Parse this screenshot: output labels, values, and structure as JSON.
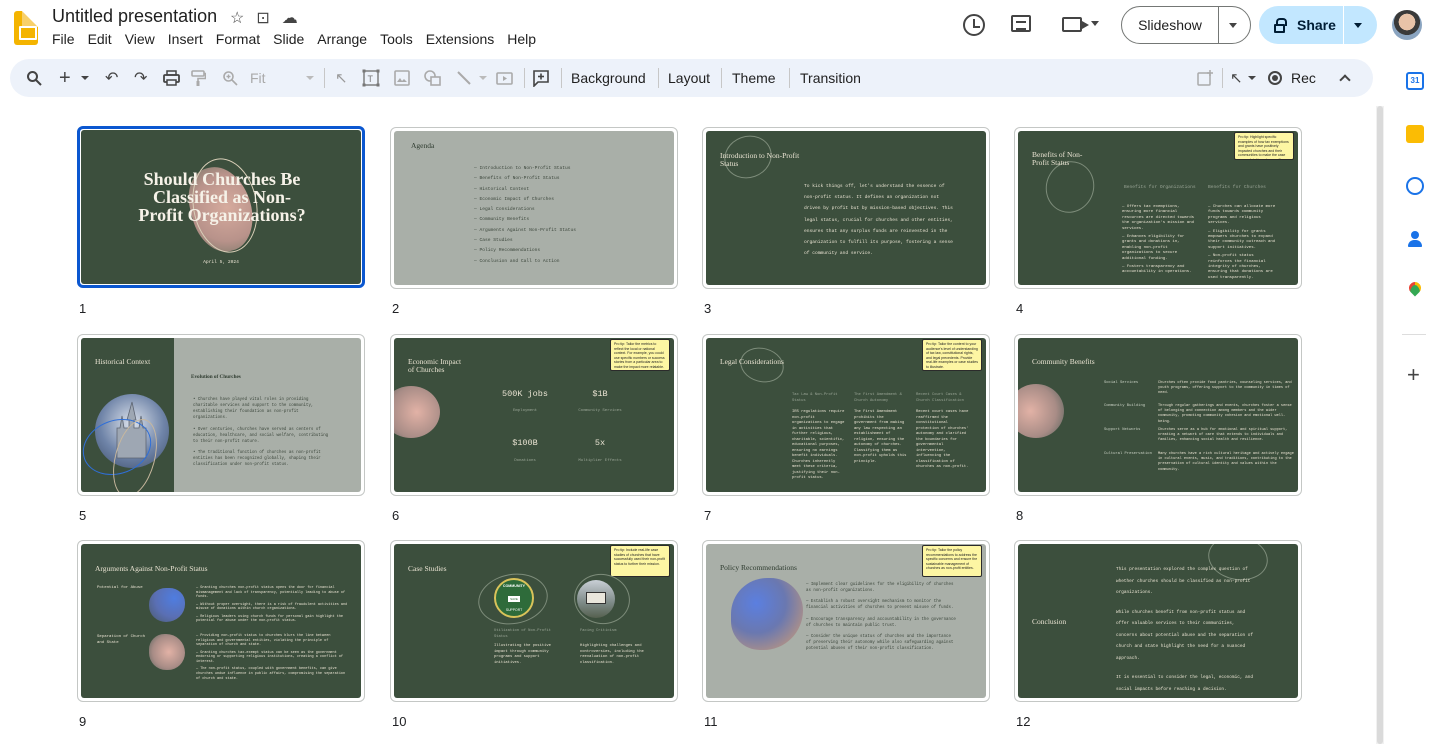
{
  "doc": {
    "title": "Untitled presentation"
  },
  "menu": [
    "File",
    "Edit",
    "View",
    "Insert",
    "Format",
    "Slide",
    "Arrange",
    "Tools",
    "Extensions",
    "Help"
  ],
  "header": {
    "slideshow": "Slideshow",
    "share": "Share"
  },
  "toolbar": {
    "zoom": "Fit",
    "background": "Background",
    "layout": "Layout",
    "theme": "Theme",
    "transition": "Transition",
    "rec": "Rec"
  },
  "slides": {
    "s1": {
      "num": "1",
      "title": "Should Churches Be Classified as Non-Profit Organizations?",
      "date": "April 5, 2024"
    },
    "s2": {
      "num": "2",
      "title": "Agenda",
      "items": [
        "Introduction to Non-Profit Status",
        "Benefits of Non-Profit Status",
        "Historical Context",
        "Economic Impact of Churches",
        "Legal Considerations",
        "Community Benefits",
        "Arguments Against Non-Profit Status",
        "Case Studies",
        "Policy Recommendations",
        "Conclusion and Call to Action"
      ]
    },
    "s3": {
      "num": "3",
      "title": "Introduction to Non-Profit Status",
      "body": "To kick things off, let's understand the essence of non-profit status. It defines an organization not driven by profit but by mission-based objectives. This legal status, crucial for churches and other entities, ensures that any surplus funds are reinvested in the organization to fulfill its purpose, fostering a sense of community and service."
    },
    "s4": {
      "num": "4",
      "title": "Benefits of Non-Profit Status",
      "col1": "Benefits for Organizations",
      "col2": "Benefits for Churches",
      "tip": "Pro tip: Highlight specific examples of how tax exemptions and grants have positively impacted churches and their communities to make the case more relatable and compelling.",
      "items1": [
        "Offers tax exemptions, ensuring more financial resources are directed towards the organization's mission and services.",
        "Enhances eligibility for grants and donations in, enabling non-profit organizations to secure additional funding.",
        "Fosters transparency and accountability in operations."
      ],
      "items2": [
        "Churches can allocate more funds towards community programs and religious services.",
        "Eligibility for grants empowers churches to expand their community outreach and support initiatives.",
        "Non-profit status reinforces the financial integrity of churches, ensuring that donations are used transparently."
      ]
    },
    "s5": {
      "num": "5",
      "title": "Historical Context",
      "subtitle": "Evolution of Churches",
      "items": [
        "Churches have played vital roles in providing charitable services and support to the community, establishing their foundation as non-profit organizations.",
        "Over centuries, churches have served as centers of education, healthcare, and social welfare, contributing to their non-profit nature.",
        "The traditional function of churches as non-profit entities has been recognized globally, shaping their classification under non-profit status."
      ]
    },
    "s6": {
      "num": "6",
      "title": "Economic Impact of Churches",
      "stats": [
        {
          "v": "500K jobs",
          "l": "Employment"
        },
        {
          "v": "$1B",
          "l": "Community Services"
        },
        {
          "v": "$100B",
          "l": "Donations"
        },
        {
          "v": "5x",
          "l": "Multiplier Effects"
        }
      ],
      "tip": "Pro tip: Tailor the metrics to reflect the local or national context. For example, you could use specific numbers or success stories from a particular area to make the impact more relatable."
    },
    "s7": {
      "num": "7",
      "title": "Legal Considerations",
      "tip": "Pro tip: Tailor the content to your audience's level of understanding of tax law, constitutional rights, and legal precedents. Provide real-life examples or case studies to illustrate.",
      "cols": [
        {
          "h": "Tax Law & Non-Profit Status",
          "b": "IRS regulations require non-profit organizations to engage in activities that further religious, charitable, scientific, educational purposes, ensuring no earnings benefit individuals. Churches inherently meet these criteria, justifying their non-profit status."
        },
        {
          "h": "The First Amendment & Church Autonomy",
          "b": "The First Amendment prohibits the government from making any law respecting an establishment of religion, ensuring the autonomy of churches. Classifying them as non-profit upholds this principle."
        },
        {
          "h": "Recent Court Cases & Church Classification",
          "b": "Recent court cases have reaffirmed the constitutional protection of churches' autonomy and clarified the boundaries for governmental intervention, influencing the classification of churches as non-profit."
        }
      ]
    },
    "s8": {
      "num": "8",
      "title": "Community Benefits",
      "rows": [
        {
          "k": "Social Services",
          "v": "Churches often provide food pantries, counseling services, and youth programs, offering support to the community in times of need."
        },
        {
          "k": "Community Building",
          "v": "Through regular gatherings and events, churches foster a sense of belonging and connection among members and the wider community, promoting community cohesion and emotional well-being."
        },
        {
          "k": "Support Networks",
          "v": "Churches serve as a hub for emotional and spiritual support, creating a network of care that extends to individuals and families, enhancing social health and resilience."
        },
        {
          "k": "Cultural Preservation",
          "v": "Many churches have a rich cultural heritage and actively engage in cultural events, music, and traditions, contributing to the preservation of cultural identity and values within the community."
        }
      ]
    },
    "s9": {
      "num": "9",
      "title": "Arguments Against Non-Profit Status",
      "g1": "Potential for Abuse",
      "g2": "Separation of Church and State",
      "items1": [
        "Granting churches non-profit status opens the door for financial mismanagement and lack of transparency, potentially leading to abuse of funds.",
        "Without proper oversight, there is a risk of fraudulent activities and misuse of donations within church organizations.",
        "Religious leaders using church funds for personal gain highlight the potential for abuse under the non-profit status."
      ],
      "items2": [
        "Providing non-profit status to churches blurs the line between religious and governmental entities, violating the principle of separation of church and state.",
        "Granting churches tax-exempt status can be seen as the government endorsing or supporting religious institutions, creating a conflict of interest.",
        "The non-profit status, coupled with government benefits, can give churches undue influence in public affairs, compromising the separation of church and state."
      ]
    },
    "s10": {
      "num": "10",
      "title": "Case Studies",
      "tip": "Pro tip: Include real-life case studies of churches that have successfully used their non-profit status to further their mission.",
      "logo_top": "COMMUNITY",
      "logo_mid": "SAVE",
      "logo_bot": "SUPPORT",
      "c1h": "Utilization of Non-Profit Status",
      "c1b": "Illustrating the positive impact through community programs and support initiatives.",
      "c2h": "Facing Criticism",
      "c2b": "Highlighting challenges and controversies, including the reevaluation of non-profit classification."
    },
    "s11": {
      "num": "11",
      "title": "Policy Recommendations",
      "tip": "Pro tip: Tailor the policy recommendations to address the specific concerns and ensure the sustainable management of churches as non-profit entities.",
      "items": [
        "Implement clear guidelines for the eligibility of churches as non-profit organizations.",
        "Establish a robust oversight mechanism to monitor the financial activities of churches to prevent misuse of funds.",
        "Encourage transparency and accountability in the governance of churches to maintain public trust.",
        "Consider the unique status of churches and the importance of preserving their autonomy while also safeguarding against potential abuses of their non-profit classification."
      ]
    },
    "s12": {
      "num": "12",
      "title": "Conclusion",
      "paras": [
        "This presentation explored the complex question of whether churches should be classified as non-profit organizations.",
        "While churches benefit from non-profit status and offer valuable services to their communities, concerns about potential abuse and the separation of church and state highlight the need for a nuanced approach.",
        "It is essential to consider the legal, economic, and social impacts before reaching a decision."
      ]
    }
  },
  "colors": {
    "slide_green": "#3c4f3d",
    "slide_gray": "#a9afa8",
    "accent_blue": "#0b57d0",
    "share_bg": "#c2e7ff"
  }
}
